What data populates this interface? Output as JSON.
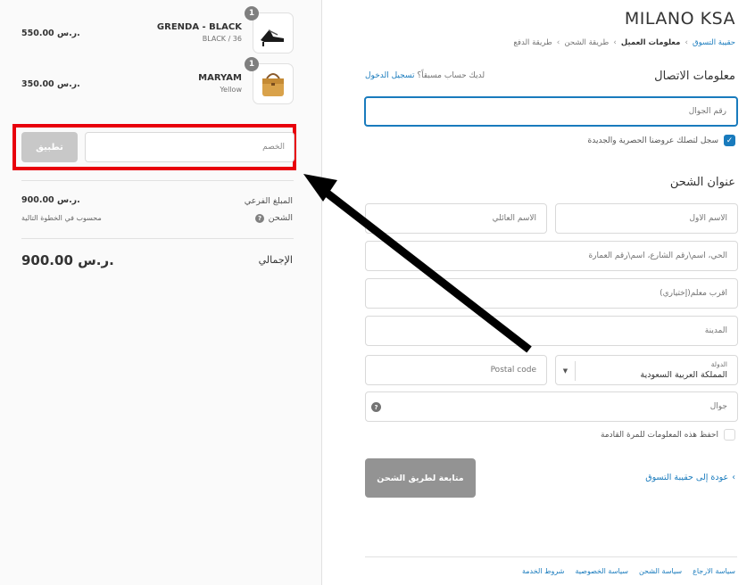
{
  "cart": {
    "items": [
      {
        "name": "GRENDA - BLACK",
        "variant": "BLACK / 36",
        "price": "550.00 ر.س.",
        "quantity": "1",
        "image_icon": "sandal-icon"
      },
      {
        "name": "MARYAM",
        "variant": "Yellow",
        "price": "350.00 ر.س.",
        "quantity": "1",
        "image_icon": "handbag-icon"
      }
    ],
    "discount": {
      "placeholder": "الخصم",
      "apply_label": "تطبيق"
    },
    "subtotal_label": "المبلغ الفرعي",
    "subtotal_value": "900.00 ر.س.",
    "shipping_label": "الشحن",
    "shipping_value": "محسوب في الخطوة التالية",
    "total_label": "الإجمالي",
    "total_value": "900.00 ر.س."
  },
  "header": {
    "store_name": "MILANO KSA",
    "breadcrumb": [
      {
        "label": "حقيبة التسوق",
        "state": "link"
      },
      {
        "label": "معلومات العميل",
        "state": "current"
      },
      {
        "label": "طريقة الشحن",
        "state": "muted"
      },
      {
        "label": "طريقة الدفع",
        "state": "muted"
      }
    ]
  },
  "contact": {
    "title": "معلومات الاتصال",
    "login_prompt": "لديك حساب مسبقاً؟",
    "login_link": "تسجيل الدخول",
    "phone_placeholder": "رقم الجوال",
    "marketing_opt_in": {
      "label": "سجل لتصلك عروضنا الحصرية والجديدة",
      "checked": true
    }
  },
  "shipping_address": {
    "title": "عنوان الشحن",
    "first_name_placeholder": "الاسم الأول",
    "last_name_placeholder": "الاسم العائلي",
    "address_placeholder": "الحي، اسم\\رقم الشارع، اسم\\رقم العمارة",
    "landmark_placeholder": "أقرب معلم(إختياري)",
    "city_placeholder": "المدينة",
    "country_label": "الدولة",
    "country_value": "المملكة العربية السعودية",
    "postal_placeholder": "Postal code",
    "phone_placeholder": "جوال",
    "save_info": {
      "label": "احفظ هذه المعلومات للمرة القادمة",
      "checked": false
    }
  },
  "actions": {
    "continue_label": "متابعة لطريق الشحن",
    "back_label": "عودة إلى حقيبة التسوق"
  },
  "footer": {
    "links": [
      "سياسة الارجاع",
      "سياسة الشحن",
      "سياسة الخصوصية",
      "شروط الخدمة"
    ]
  },
  "colors": {
    "accent": "#197bbd",
    "highlight": "#e8000b",
    "button_disabled": "#c8c8c8"
  }
}
